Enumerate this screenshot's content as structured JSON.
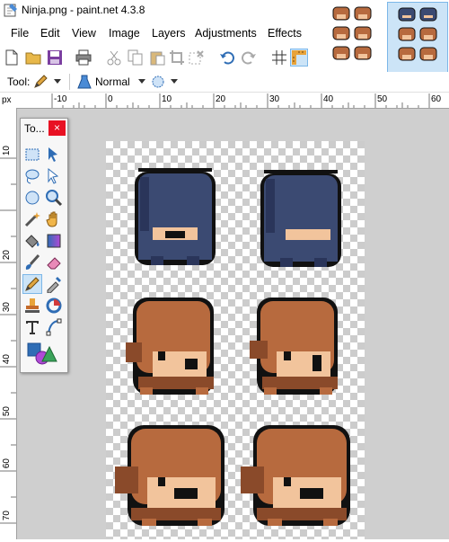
{
  "window": {
    "title": "Ninja.png - paint.net 4.3.8"
  },
  "menu": [
    "File",
    "Edit",
    "View",
    "Image",
    "Layers",
    "Adjustments",
    "Effects"
  ],
  "toolbar2": {
    "tool_label": "Tool:",
    "blend_mode": "Normal"
  },
  "ruler": {
    "unit": "px",
    "h_ticks": [
      "-10",
      "0",
      "10",
      "20",
      "30",
      "40",
      "50",
      "60"
    ],
    "v_ticks": [
      "10",
      "20",
      "30",
      "40",
      "50",
      "60",
      "70"
    ]
  },
  "tools_window": {
    "title": "To...",
    "close": "×"
  },
  "colors": {
    "ninja_navy": "#3b4a72",
    "ninja_navy_dark": "#2a355a",
    "skin": "#f2c49c",
    "hair": "#b76a3e",
    "hair_dark": "#8a4a2a",
    "outline": "#111111",
    "selection_blue": "#cce4f7"
  },
  "tools": [
    "rectangle-select-icon",
    "move-selection-icon",
    "lasso-select-icon",
    "move-selected-icon",
    "ellipse-select-icon",
    "zoom-icon",
    "magic-wand-icon",
    "pan-icon",
    "paint-bucket-icon",
    "gradient-icon",
    "paintbrush-icon",
    "eraser-icon",
    "pencil-icon",
    "color-picker-icon",
    "clone-stamp-icon",
    "recolor-icon",
    "text-icon",
    "line-curve-icon",
    "shapes-icon"
  ]
}
